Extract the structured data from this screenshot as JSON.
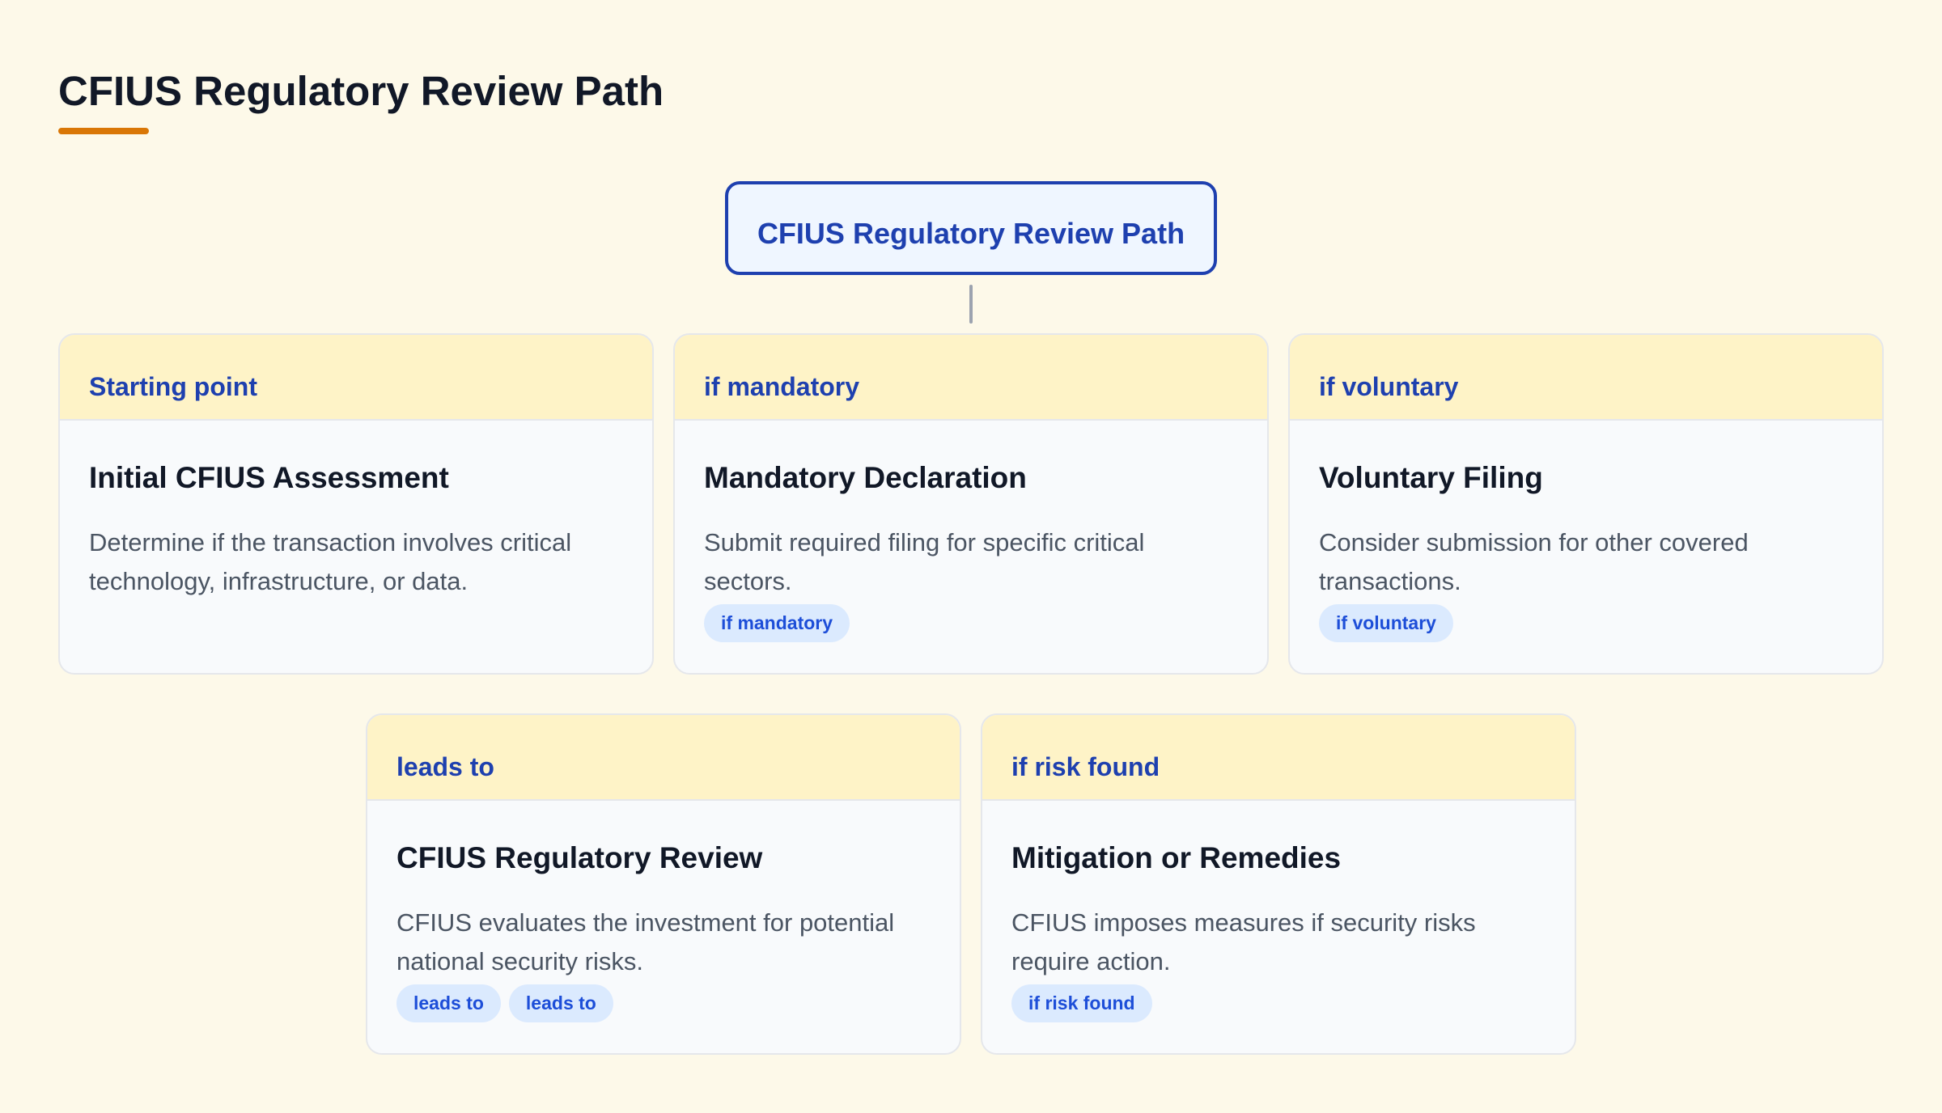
{
  "header": {
    "title": "CFIUS Regulatory Review Path",
    "accent_color": "#d97706"
  },
  "root": {
    "label": "CFIUS Regulatory Review Path"
  },
  "cards": [
    {
      "tag": "Starting point",
      "title": "Initial CFIUS Assessment",
      "description": "Determine if the transaction involves critical technology, infrastructure, or data.",
      "chips": []
    },
    {
      "tag": "if mandatory",
      "title": "Mandatory Declaration",
      "description": "Submit required filing for specific critical sectors.",
      "chips": [
        "if mandatory"
      ]
    },
    {
      "tag": "if voluntary",
      "title": "Voluntary Filing",
      "description": "Consider submission for other covered transactions.",
      "chips": [
        "if voluntary"
      ]
    },
    {
      "tag": "leads to",
      "title": "CFIUS Regulatory Review",
      "description": "CFIUS evaluates the investment for potential national security risks.",
      "chips": [
        "leads to",
        "leads to"
      ]
    },
    {
      "tag": "if risk found",
      "title": "Mitigation or Remedies",
      "description": "CFIUS imposes measures if security risks require action.",
      "chips": [
        "if risk found"
      ]
    }
  ]
}
